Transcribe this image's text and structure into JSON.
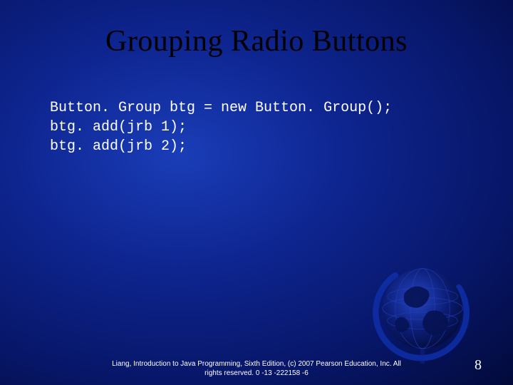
{
  "slide": {
    "title": "Grouping Radio Buttons",
    "code_lines": [
      "Button. Group btg = new Button. Group();",
      "btg. add(jrb 1);",
      "btg. add(jrb 2);"
    ],
    "footer_line1": "Liang, Introduction to Java Programming, Sixth Edition, (c) 2007 Pearson Education, Inc. All",
    "footer_line2": "rights reserved. 0 -13 -222158 -6",
    "page_number": "8"
  }
}
